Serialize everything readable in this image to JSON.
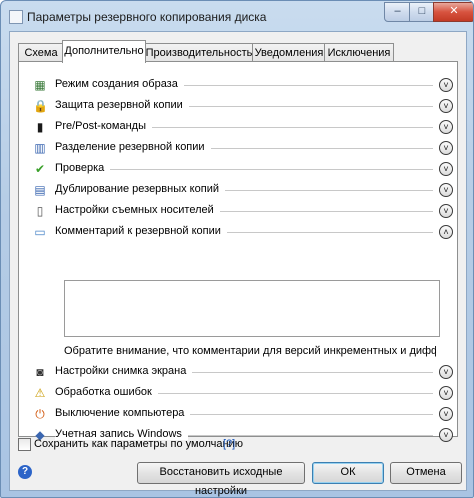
{
  "window": {
    "title": "Параметры резервного копирования диска",
    "controls": {
      "minimize": "–",
      "maximize": "□",
      "close": "✕"
    }
  },
  "tabs": [
    {
      "label": "Схема",
      "active": false
    },
    {
      "label": "Дополнительно",
      "active": true
    },
    {
      "label": "Производительность",
      "active": false
    },
    {
      "label": "Уведомления",
      "active": false
    },
    {
      "label": "Исключения",
      "active": false
    }
  ],
  "sections": [
    {
      "label": "Режим создания образа",
      "icon": "image-mode-icon",
      "glyph": "▦",
      "color": "#3a7a3a",
      "expanded": false
    },
    {
      "label": "Защита резервной копии",
      "icon": "lock-icon",
      "glyph": "🔒",
      "color": "#8a6d1e",
      "expanded": false
    },
    {
      "label": "Pre/Post-команды",
      "icon": "console-icon",
      "glyph": "▮",
      "color": "#1a1a1a",
      "expanded": false
    },
    {
      "label": "Разделение резервной копии",
      "icon": "split-icon",
      "glyph": "▥",
      "color": "#3a66b0",
      "expanded": false
    },
    {
      "label": "Проверка",
      "icon": "checkmark-icon",
      "glyph": "✔",
      "color": "#3aa02a",
      "expanded": false
    },
    {
      "label": "Дублирование резервных копий",
      "icon": "duplicate-icon",
      "glyph": "▤",
      "color": "#3a66b0",
      "expanded": false
    },
    {
      "label": "Настройки съемных носителей",
      "icon": "removable-media-icon",
      "glyph": "▯",
      "color": "#555555",
      "expanded": false
    },
    {
      "label": "Комментарий к резервной копии",
      "icon": "comment-icon",
      "glyph": "▭",
      "color": "#4a86c8",
      "expanded": true
    }
  ],
  "comment": {
    "value": "",
    "note": "Обратите внимание, что комментарии для версий инкрементных и дифференци..."
  },
  "sections_after": [
    {
      "label": "Настройки снимка экрана",
      "icon": "camera-icon",
      "glyph": "◙",
      "color": "#333333",
      "expanded": false
    },
    {
      "label": "Обработка ошибок",
      "icon": "warning-icon",
      "glyph": "⚠",
      "color": "#c99a00",
      "expanded": false
    },
    {
      "label": "Выключение компьютера",
      "icon": "power-icon",
      "glyph": "⏻",
      "color": "#d25a10",
      "expanded": false
    },
    {
      "label": "Учетная запись Windows",
      "icon": "shield-icon",
      "glyph": "◆",
      "color": "#3a66b0",
      "expanded": false
    }
  ],
  "footer": {
    "save_default_label": "Сохранить как параметры по умолчанию",
    "help_link": "[?]",
    "help_icon": "?",
    "restore_label": "Восстановить исходные настройки",
    "ok_label": "ОК",
    "cancel_label": "Отмена"
  }
}
